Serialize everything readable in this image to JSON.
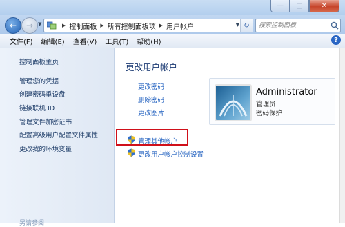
{
  "window": {
    "minimize_glyph": "—",
    "maximize_glyph": "□",
    "close_glyph": "✕"
  },
  "nav": {
    "back_glyph": "←",
    "forward_glyph": "→",
    "breadcrumbs": [
      "控制面板",
      "所有控制面板项",
      "用户帐户"
    ],
    "refresh_glyph": "↻",
    "search_placeholder": "搜索控制面板",
    "search_icon": "search-icon"
  },
  "menu": {
    "items": [
      "文件(F)",
      "编辑(E)",
      "查看(V)",
      "工具(T)",
      "帮助(H)"
    ],
    "help_glyph": "?"
  },
  "sidebar": {
    "home": "控制面板主页",
    "items": [
      "管理您的凭据",
      "创建密码重设盘",
      "链接联机 ID",
      "管理文件加密证书",
      "配置高级用户配置文件属性",
      "更改我的环境变量"
    ],
    "see_also": "另请参阅"
  },
  "main": {
    "title": "更改用户帐户",
    "links": [
      "更改密码",
      "删除密码",
      "更改图片"
    ],
    "shield_links": [
      "管理其他帐户",
      "更改用户帐户控制设置"
    ]
  },
  "account": {
    "name": "Administrator",
    "role": "管理员",
    "status": "密码保护"
  },
  "colors": {
    "link": "#1f5fbf",
    "title": "#1e3d75",
    "highlight": "#d0101a"
  }
}
